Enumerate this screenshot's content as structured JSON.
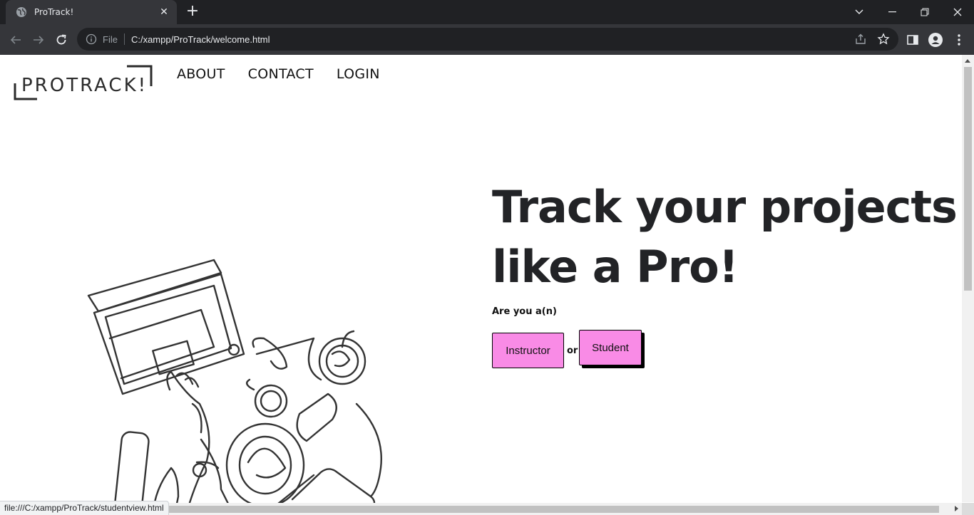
{
  "browser": {
    "tab_title": "ProTrack!",
    "tab_close": "✕",
    "new_tab": "+",
    "url_scheme": "File",
    "url": "C:/xampp/ProTrack/welcome.html",
    "status_url": "file:///C:/xampp/ProTrack/studentview.html"
  },
  "site": {
    "logo_text": "PROTRACK!",
    "nav": [
      "ABOUT",
      "CONTACT",
      "LOGIN"
    ]
  },
  "hero": {
    "headline_line1": "Track your projects",
    "headline_line2": "like a Pro!",
    "question": "Are you a(n)",
    "instructor_button": "Instructor",
    "or_text": "or",
    "student_button": "Student"
  },
  "colors": {
    "button_pink": "#f98be6",
    "headline": "#222326"
  }
}
